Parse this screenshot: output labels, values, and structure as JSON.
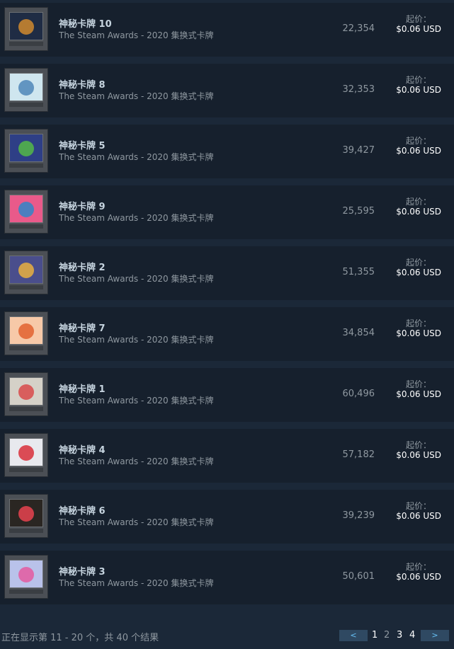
{
  "listing": {
    "rows": [
      {
        "name": "神秘卡牌 10",
        "game": "The Steam Awards - 2020 集换式卡牌",
        "quantity": "22,354",
        "price_label": "起价：",
        "price": "$0.06 USD",
        "art": "#1f2c44",
        "accent": "#d08a2e"
      },
      {
        "name": "神秘卡牌 8",
        "game": "The Steam Awards - 2020 集换式卡牌",
        "quantity": "32,353",
        "price_label": "起价：",
        "price": "$0.06 USD",
        "art": "#cfe6ef",
        "accent": "#4f86b8"
      },
      {
        "name": "神秘卡牌 5",
        "game": "The Steam Awards - 2020 集换式卡牌",
        "quantity": "39,427",
        "price_label": "起价：",
        "price": "$0.06 USD",
        "art": "#2e3f86",
        "accent": "#53b946"
      },
      {
        "name": "神秘卡牌 9",
        "game": "The Steam Awards - 2020 集换式卡牌",
        "quantity": "25,595",
        "price_label": "起价：",
        "price": "$0.06 USD",
        "art": "#e95a8a",
        "accent": "#2f86c8"
      },
      {
        "name": "神秘卡牌 2",
        "game": "The Steam Awards - 2020 集换式卡牌",
        "quantity": "51,355",
        "price_label": "起价：",
        "price": "$0.06 USD",
        "art": "#4a4e8c",
        "accent": "#e9b040"
      },
      {
        "name": "神秘卡牌 7",
        "game": "The Steam Awards - 2020 集换式卡牌",
        "quantity": "34,854",
        "price_label": "起价：",
        "price": "$0.06 USD",
        "art": "#f7c9a8",
        "accent": "#e2612f"
      },
      {
        "name": "神秘卡牌 1",
        "game": "The Steam Awards - 2020 集换式卡牌",
        "quantity": "60,496",
        "price_label": "起价：",
        "price": "$0.06 USD",
        "art": "#d5d1c8",
        "accent": "#d84a4a"
      },
      {
        "name": "神秘卡牌 4",
        "game": "The Steam Awards - 2020 集换式卡牌",
        "quantity": "57,182",
        "price_label": "起价：",
        "price": "$0.06 USD",
        "art": "#e8e9ee",
        "accent": "#d82f3a"
      },
      {
        "name": "神秘卡牌 6",
        "game": "The Steam Awards - 2020 集换式卡牌",
        "quantity": "39,239",
        "price_label": "起价：",
        "price": "$0.06 USD",
        "art": "#2a2622",
        "accent": "#e8434f"
      },
      {
        "name": "神秘卡牌 3",
        "game": "The Steam Awards - 2020 集换式卡牌",
        "quantity": "50,601",
        "price_label": "起价：",
        "price": "$0.06 USD",
        "art": "#b9c2ea",
        "accent": "#e45aa0"
      }
    ]
  },
  "footer": {
    "summary": "正在显示第 11 - 20 个，共 40 个结果",
    "prev": "<",
    "next": ">",
    "pages": [
      "1",
      "2",
      "3",
      "4"
    ],
    "current_page": "2"
  },
  "colors": {
    "page_bg": "#1b2838",
    "row_bg": "#16202d",
    "link_blue": "#67c1f5",
    "button_bg": "#2f4962"
  }
}
